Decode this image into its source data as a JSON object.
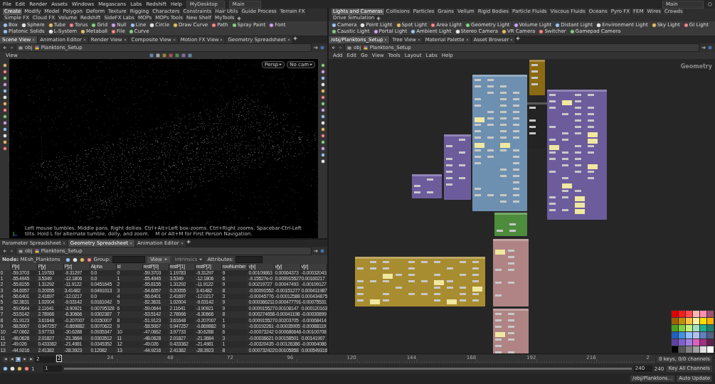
{
  "menubar": {
    "menus": [
      "File",
      "Edit",
      "Render",
      "Assets",
      "Windows",
      "Megascans",
      "Labs",
      "Redshift",
      "Help"
    ],
    "desktop": "MyDesktop",
    "desktop_main": "Main",
    "right_main": "Main"
  },
  "left": {
    "shelf_tabs": [
      {
        "label": "Create",
        "selected": true
      },
      {
        "label": "Modify",
        "selected": false
      },
      {
        "label": "Model",
        "selected": false
      },
      {
        "label": "Polygon",
        "selected": false
      },
      {
        "label": "Deform",
        "selected": false
      },
      {
        "label": "Texture",
        "selected": false
      },
      {
        "label": "Rigging",
        "selected": false
      },
      {
        "label": "Characters",
        "selected": false
      },
      {
        "label": "Constraints",
        "selected": false
      },
      {
        "label": "Hair Utils",
        "selected": false
      },
      {
        "label": "Guide Process",
        "selected": false
      },
      {
        "label": "Terrain FX",
        "selected": false
      },
      {
        "label": "Simple FX",
        "selected": false
      },
      {
        "label": "Cloud FX",
        "selected": false
      },
      {
        "label": "Volume",
        "selected": false
      },
      {
        "label": "Redshift",
        "selected": false
      },
      {
        "label": "SideFX Labs",
        "selected": false
      },
      {
        "label": "MOPs",
        "selected": false
      },
      {
        "label": "MOPs Tools",
        "selected": false
      },
      {
        "label": "New Shelf",
        "selected": false
      },
      {
        "label": "MyTools",
        "selected": false
      }
    ],
    "shelf_tools": [
      "Box",
      "Sphere",
      "Tube",
      "Torus",
      "Grid",
      "Null",
      "Line",
      "Circle",
      "Draw Curve",
      "Path",
      "Spray Paint",
      "Font",
      "Platonic Solids",
      "L-System",
      "Metaball",
      "File",
      "Curve"
    ],
    "pane_tabs": [
      {
        "label": "Scene View",
        "selected": true
      },
      {
        "label": "Animation Editor",
        "selected": false
      },
      {
        "label": "Render View",
        "selected": false
      },
      {
        "label": "Composite View",
        "selected": false
      },
      {
        "label": "Motion FX View",
        "selected": false
      },
      {
        "label": "Geometry Spreadsheet",
        "selected": false
      }
    ],
    "path": [
      "obj",
      "Planktons_Setup"
    ],
    "viewport": {
      "title": "View",
      "menus": [
        "Persp",
        "No cam"
      ],
      "hint": "Left mouse tumbles. Middle pans. Right dollies. Ctrl+Alt+Left box-zooms. Ctrl+Right zooms. Spacebar-Ctrl-Left tilts. Hold L for alternate tumble, dolly, and zoom.    M or Alt+M for First Person Navigation."
    }
  },
  "spreadsheet": {
    "tabs": [
      {
        "label": "Parameter Spreadsheet",
        "selected": false
      },
      {
        "label": "Geometry Spreadsheet",
        "selected": true
      },
      {
        "label": "Animation Editor",
        "selected": false
      }
    ],
    "path": [
      "obj",
      "Planktons_Setup"
    ],
    "node": "**Node:** MEsh_Planktons",
    "group_label": "Group:",
    "view_menu": "View",
    "intrinsics_menu": {
      "label": "Intrinsics",
      "disabled": true
    },
    "attributes_label": "Attributes:",
    "columns": [
      "",
      "P[x]",
      "P[y]",
      "P[z]",
      "Alpha",
      "id",
      "restP[0]",
      "restP[1]",
      "restP[2]",
      "rowNumber",
      "v[x]",
      "v[y]",
      "v[z]"
    ],
    "rows": [
      [
        "0",
        "-59.3703",
        "1.19783",
        "-9.31297",
        "0.0",
        "0",
        "-59.3703",
        "1.19783",
        "-9.31297",
        "9",
        "0.00109863",
        "0.00064373",
        "-0.00032043"
      ],
      [
        "1",
        "-55.4945",
        "3.5349",
        "-12.1806",
        "0.0",
        "1",
        "-55.4945",
        "3.5349",
        "-12.1806",
        "6",
        "-9.15527e-0",
        "0.000915527",
        "0.00160217"
      ],
      [
        "2",
        "-55.8155",
        "1.31292",
        "-11.9122",
        "0.0451645",
        "2",
        "-55.8155",
        "1.31292",
        "-11.9122",
        "9",
        "0.00219727",
        "0.00047493",
        "-0.00199127"
      ],
      [
        "3",
        "-54.6057",
        "0.20055",
        "3.41482",
        "0.0491013",
        "3",
        "-54.6057",
        "0.20055",
        "3.41482",
        "8",
        "-0.00091552",
        "-0.00151277",
        "0.000411987"
      ],
      [
        "4",
        "-56.6401",
        "2.41697",
        "-12.0217",
        "0.0",
        "4",
        "-56.6401",
        "2.41697",
        "-12.0217",
        "3",
        "-0.00045776",
        "-0.00012588",
        "0.000434875"
      ],
      [
        "5",
        "-52.3631",
        "1.02004",
        "-9.03142",
        "0.0161042",
        "5",
        "-52.3631",
        "1.02004",
        "-9.03142",
        "9",
        "0.000366211",
        "0.000477791",
        "-0.00075531"
      ],
      [
        "6",
        "-59.0644",
        "2.11641",
        "-3.90921",
        "0.00795328",
        "6",
        "-59.0644",
        "2.11641",
        "-3.90921",
        "9",
        "0.000915527",
        "0.00108147",
        "0.000120163"
      ],
      [
        "7",
        "-53.5142",
        "2.78066",
        "-6.30666",
        "0.0302387",
        "7",
        "-53.5142",
        "2.78066",
        "-6.30666",
        "8",
        "0.000274658",
        "-0.00041198",
        "-0.00030899"
      ],
      [
        "8",
        "-51.9123",
        "3.61648",
        "-0.207007",
        "0.0150007",
        "8",
        "-51.9123",
        "3.61648",
        "-0.207007",
        "1",
        "0.000915527",
        "0.00203705",
        "-0.00068414"
      ],
      [
        "9",
        "-58.5067",
        "0.947257",
        "-0.869882",
        "0.0070622",
        "9",
        "-58.5067",
        "0.947257",
        "-0.869882",
        "9",
        "-0.00192261",
        "-0.00035905",
        "-0.00088119"
      ],
      [
        "10",
        "-47.0662",
        "3.97733",
        "-30.6288",
        "0.0935347",
        "10",
        "-47.0662",
        "3.97733",
        "-30.6288",
        "6",
        "-0.00073242",
        "0.000686646",
        "-0.00100708"
      ],
      [
        "11",
        "-48.0628",
        "2.01827",
        "-21.3684",
        "0.0303512",
        "11",
        "-48.0628",
        "2.01827",
        "-21.3684",
        "3",
        "-0.00036621",
        "0.00158501",
        "0.00141907"
      ],
      [
        "12",
        "-49.026",
        "0.433362",
        "-21.4981",
        "0.0345352",
        "12",
        "-49.026",
        "0.433362",
        "-21.4981",
        "1",
        "-0.00320435",
        "-0.00126386",
        "-0.00064086"
      ],
      [
        "13",
        "-44.9216",
        "2.41382",
        "-28.3923",
        "0.12082",
        "13",
        "-44.9216",
        "2.41382",
        "-28.3923",
        "8",
        "0.000732422",
        "0.00105858",
        "0.000549316"
      ]
    ]
  },
  "right": {
    "shelf_tabs": [
      {
        "label": "Lights and Cameras",
        "selected": true
      },
      {
        "label": "Collisions",
        "selected": false
      },
      {
        "label": "Particles",
        "selected": false
      },
      {
        "label": "Grains",
        "selected": false
      },
      {
        "label": "Vellum",
        "selected": false
      },
      {
        "label": "Rigid Bodies",
        "selected": false
      },
      {
        "label": "Particle Fluids",
        "selected": false
      },
      {
        "label": "Viscous Fluids",
        "selected": false
      },
      {
        "label": "Oceans",
        "selected": false
      },
      {
        "label": "Pyro FX",
        "selected": false
      },
      {
        "label": "FEM",
        "selected": false
      },
      {
        "label": "Wires",
        "selected": false
      },
      {
        "label": "Crowds",
        "selected": false
      },
      {
        "label": "Drive Simulation",
        "selected": false
      }
    ],
    "shelf_tools": [
      "Camera",
      "Point Light",
      "Spot Light",
      "Area Light",
      "Geometry Light",
      "Volume Light",
      "Distant Light",
      "Environment Light",
      "Sky Light",
      "GI Light",
      "Caustic Light",
      "Portal Light",
      "Ambient Light",
      "Stereo Camera",
      "VR Camera",
      "Switcher",
      "Gamepad Camera"
    ],
    "pane_tabs": [
      {
        "label": "/obj/Planktons_Setup",
        "selected": true
      },
      {
        "label": "Tree View",
        "selected": false
      },
      {
        "label": "Material Palette",
        "selected": false
      },
      {
        "label": "Asset Browser",
        "selected": false
      }
    ],
    "path": [
      "obj",
      "Planktons_Setup"
    ],
    "network_menus": [
      "Add",
      "Edit",
      "Go",
      "View",
      "Tools",
      "Layout",
      "Labs",
      "Help"
    ],
    "canvas_label": "Geometry",
    "network_boxes": [
      {
        "color": "#8a6a12"
      },
      {
        "color": "#6e90b0"
      },
      {
        "color": "#232323"
      },
      {
        "color": "#6c5c9c"
      },
      {
        "color": "#6c5c9c"
      },
      {
        "color": "#6c5c9c"
      },
      {
        "color": "#4c8c3c"
      },
      {
        "color": "#b08484"
      },
      {
        "color": "#a88c30"
      },
      {
        "color": "#b08484"
      }
    ],
    "palette": [
      {
        "color": "#e00000"
      },
      {
        "color": "#ff1a1a"
      },
      {
        "color": "#ff4d4d"
      },
      {
        "color": "#ffb3b3"
      },
      {
        "color": "#ff8fb0"
      },
      {
        "color": "#a05070"
      },
      {
        "color": "#a06000"
      },
      {
        "color": "#c09000"
      },
      {
        "color": "#ffc040"
      },
      {
        "color": "#fff0a0"
      },
      {
        "color": "#ffe000"
      },
      {
        "color": "#ffb000"
      },
      {
        "color": "#50a020"
      },
      {
        "color": "#80d040"
      },
      {
        "color": "#c0f080"
      },
      {
        "color": "#a0e0c0"
      },
      {
        "color": "#20b090"
      },
      {
        "color": "#208070"
      },
      {
        "color": "#2060c0"
      },
      {
        "color": "#4090e0"
      },
      {
        "color": "#90c0ff"
      },
      {
        "color": "#b0c0f0"
      },
      {
        "color": "#6080c0"
      },
      {
        "color": "#506080"
      },
      {
        "color": "#6040a0"
      },
      {
        "color": "#8060d0"
      },
      {
        "color": "#a080e0"
      },
      {
        "color": "#e060c0"
      },
      {
        "color": "#a03080"
      },
      {
        "color": "#602050"
      },
      {
        "color": "#000000"
      },
      {
        "color": "#555555"
      },
      {
        "color": "#808080"
      },
      {
        "color": "#a0a0a0"
      },
      {
        "color": "#e0e0e0"
      },
      {
        "color": "#ffffff"
      }
    ]
  },
  "timeline": {
    "range_slider": {
      "level": 1
    },
    "frame": "2",
    "marker": "2",
    "ticks": [
      "24",
      "48",
      "72",
      "96",
      "120",
      "144",
      "168",
      "192",
      "216",
      "2"
    ],
    "range_start": "1",
    "range_start_2": "1",
    "range_end": "240",
    "range_end_2": "240",
    "keys": "0 keys, 0/0 channels",
    "key_all": "Key All Channels"
  },
  "status": {
    "path": "/obj/Planktons...",
    "auto_update": "Auto Update"
  }
}
